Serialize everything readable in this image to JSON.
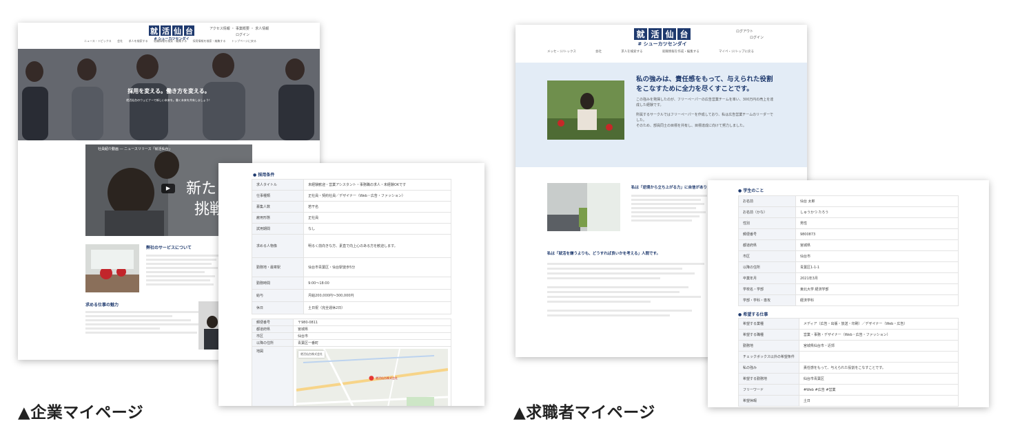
{
  "captions": {
    "company": "▲企業マイページ",
    "jobseeker": "▲求職者マイページ"
  },
  "logo": {
    "chars": [
      "就",
      "活",
      "仙",
      "台"
    ],
    "sub": "# シューカツセンダイ"
  },
  "company_page": {
    "header_links": [
      "アクセス情報 ・ 事業概要 ・ 求人情報",
      "ログイン"
    ],
    "nav": [
      "ニュース・トピックス",
      "会社",
      "求人を検索する",
      "就職情報を検索・編集する",
      "採用情報を検索・編集する",
      "トップページに戻る"
    ],
    "hero_title": "採用を変える。働き方を変える。",
    "hero_sub": "就活仙台のウェビナーで新しい未来を。働く未来を共有しましょう！",
    "video_title": "社員紹介動画 ― ニュースリリース「就活仙台」",
    "video_overlay": [
      "新た",
      "挑戦"
    ],
    "about_title": "弊社のサービスについて",
    "work_title": "求める仕事の魅力",
    "colors": {
      "brand": "#1f3a6e",
      "hero": "#6b6e73"
    }
  },
  "company_conditions": {
    "section_title": "● 採用条件",
    "rows": [
      {
        "key": "求人タイトル",
        "value": "未経験歓迎・営業アシスタント・事務職の求人・未経験OKです"
      },
      {
        "key": "仕事種類",
        "value": "正社員・契約社員／デザイナー（Web・広告・ファッション）"
      },
      {
        "key": "募集人数",
        "value": "若干名"
      },
      {
        "key": "雇用形態",
        "value": "正社員"
      },
      {
        "key": "試用期間",
        "value": "なし"
      },
      {
        "key": "求める人物像",
        "value": "明るく前向きな方、素直で向上心のある方を歓迎します。"
      },
      {
        "key": "勤務地・最寄駅",
        "value": "仙台市青葉区・仙台駅徒歩5分"
      },
      {
        "key": "勤務時間",
        "value": "9:00〜18:00"
      },
      {
        "key": "給与",
        "value": "月給200,000円〜300,000円"
      },
      {
        "key": "休日",
        "value": "土日祝（完全週休2日）"
      }
    ],
    "detail_rows": [
      {
        "key": "郵便番号",
        "value": "〒980-0811"
      },
      {
        "key": "都道府県",
        "value": "宮城県"
      },
      {
        "key": "市区",
        "value": "仙台市"
      },
      {
        "key": "以降の住所",
        "value": "青葉区一番町"
      },
      {
        "key": "地図",
        "value": ""
      }
    ],
    "map_label": "就活仙台株式会社",
    "map_pin": "就活仙台株式会社"
  },
  "jobseeker_page": {
    "user_links": [
      "ログアウト",
      "ログイン"
    ],
    "nav": [
      "メッセ・ジ/トックス",
      "会社",
      "求人を検索する",
      "就職情報を作成・編集する",
      "マイペ・ジ/トップに戻る"
    ],
    "statement": "私の強みは、責任感をもって、与えられた役割をこなすために全力を尽くすことです。",
    "statement_body": [
      "この強みを発揮したのが、フリーペーパーの広告営業チームを率い、300万円の売上を達成した経験です。",
      "所属するサークルではフリーペーパーを作成しており、私は広告営業チームのリーダーでした。",
      "そのため、部員同士の目標を共有し、目標達成に向けて努力しました。"
    ],
    "point_title": "私は「逆境から立ち上がる力」に自信があります。",
    "point2_title": "私は「就活を嫌うよりも、どうすれば良いかを考える」人間です。",
    "colors": {
      "panel": "#e3ecf6"
    }
  },
  "jobseeker_profile": {
    "section_title": "● 学生のこと",
    "rows": [
      {
        "key": "お名前",
        "value": "仙台 太郎"
      },
      {
        "key": "お名前（かな）",
        "value": "しゅうかつ たろう"
      },
      {
        "key": "性別",
        "value": "男性"
      },
      {
        "key": "郵便番号",
        "value": "9800873"
      },
      {
        "key": "都道府県",
        "value": "宮城県"
      },
      {
        "key": "市区",
        "value": "仙台市"
      },
      {
        "key": "以降の住所",
        "value": "青葉区1-1-1"
      },
      {
        "key": "卒業年月",
        "value": "2021年3月"
      },
      {
        "key": "学校名・学部",
        "value": "東北大学 経済学部"
      },
      {
        "key": "学部・学科・専攻",
        "value": "経済学科"
      }
    ],
    "section2_title": "● 希望する仕事",
    "rows2": [
      {
        "key": "希望する業種",
        "value": "メディア（広告・出版・放送・印刷）／デザイナー（Web・広告）"
      },
      {
        "key": "希望する職種",
        "value": "営業・事務・デザイナー（Web・広告・ファッション）"
      },
      {
        "key": "勤務地",
        "value": "宮城県仙台市・近郊"
      },
      {
        "key": "チェックボックス以外の希望条件",
        "value": ""
      },
      {
        "key": "私の強み",
        "value": "責任感をもって、与えられた役割をこなすことです。"
      },
      {
        "key": "希望する勤務地",
        "value": "仙台市青葉区"
      },
      {
        "key": "フリーワード",
        "value": "#Web #広告 #営業"
      },
      {
        "key": "希望休暇",
        "value": "土日"
      }
    ]
  }
}
